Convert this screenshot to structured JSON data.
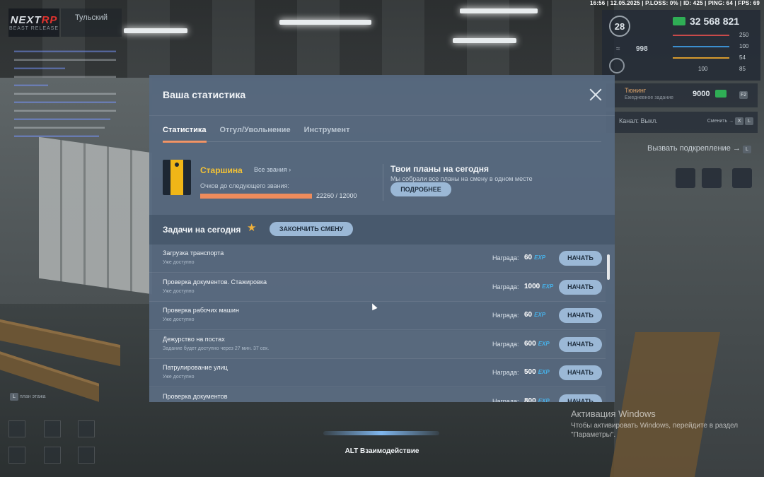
{
  "hud": {
    "logo_main_a": "NEXT",
    "logo_main_b": "RP",
    "logo_sub": "BEAST RELEASE",
    "server": "Тульский",
    "topbar": "16:56 | 12.05.2025 | P.LOSS: 0% | ID: 425 | PING: 64 | FPS: 69",
    "level": "28",
    "money": "32 568 821",
    "stats": [
      "250",
      "100",
      "54",
      "85"
    ],
    "stat_mid": "100",
    "wing_value": "998",
    "side_task_title": "Тюнинг",
    "side_task_sub": "Ежедневное задание",
    "side_task_value": "9000",
    "side_task_key": "F2",
    "channel": "Канал: Выкл.",
    "channel_right": "Сменить →",
    "channel_keys": [
      "X",
      "L"
    ],
    "backup": "Вызвать подкрепление →",
    "backup_key": "L",
    "map_key_letter": "L",
    "map_key_text": "план этажа"
  },
  "modal": {
    "title": "Ваша статистика",
    "tabs": [
      {
        "label": "Статистика",
        "active": true
      },
      {
        "label": "Отгул/Увольнение",
        "active": false
      },
      {
        "label": "Инструмент",
        "active": false
      }
    ],
    "rank": {
      "name": "Старшина",
      "all_ranks": "Все звания ›",
      "points_label": "Очков до следующего звания:",
      "points_text": "22260 / 12000",
      "progress": 1.0
    },
    "plans": {
      "title": "Твои планы на сегодня",
      "subtitle": "Мы собрали все планы на смену в одном месте",
      "button": "ПОДРОБНЕЕ"
    },
    "today": {
      "title": "Задачи на сегодня",
      "end_shift": "ЗАКОНЧИТЬ СМЕНУ"
    },
    "reward_label": "Награда:",
    "exp_label": "EXP",
    "start_label": "НАЧАТЬ",
    "tasks": [
      {
        "name": "Загрузка транспорта",
        "status": "Уже доступно",
        "reward": "60"
      },
      {
        "name": "Проверка документов. Стажировка",
        "status": "Уже доступно",
        "reward": "1000"
      },
      {
        "name": "Проверка рабочих машин",
        "status": "Уже доступно",
        "reward": "60"
      },
      {
        "name": "Дежурство на постах",
        "status": "Задание будет доступно через 27 мин. 37 сек.",
        "reward": "600"
      },
      {
        "name": "Патрулирование улиц",
        "status": "Уже доступно",
        "reward": "500"
      },
      {
        "name": "Проверка документов",
        "status": "",
        "reward": "800"
      }
    ]
  },
  "windows": {
    "title": "Активация Windows",
    "text": "Чтобы активировать Windows, перейдите в раздел \"Параметры\"."
  },
  "interact": "ALT Взаимодействие",
  "colors": {
    "accent": "#ee8c5c",
    "rank": "#f3c236",
    "button": "#9bb8d6",
    "exp": "#47b2ea"
  }
}
